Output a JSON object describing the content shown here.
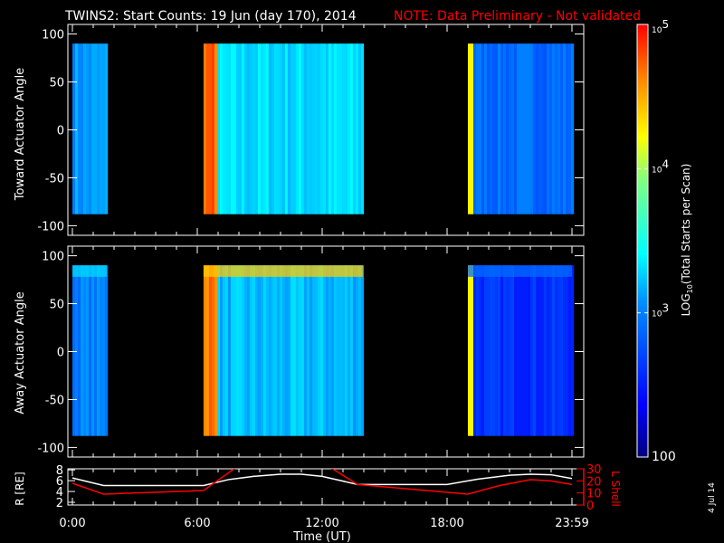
{
  "title": "TWINS2: Start Counts: 19 Jun (day 170), 2014",
  "note": "NOTE: Data Preliminary - Not validated",
  "date_stamp": "4 Jul 14",
  "colors": {
    "background": "#000000",
    "axes": "#ffffff",
    "note": "#ff0000",
    "r_line": "#ffffff",
    "lshell_line": "#ff0000"
  },
  "chart_data": [
    {
      "type": "heatmap",
      "name": "toward",
      "ylabel": "Toward Actuator Angle",
      "ylim": [
        -110,
        110
      ],
      "yticks": [
        "100",
        "50",
        "0",
        "-50",
        "-100"
      ],
      "ytick_values": [
        100,
        50,
        0,
        -50,
        -100
      ],
      "data_angle_range": [
        -88,
        90
      ],
      "data_segments_hours": [
        [
          0,
          1.65
        ],
        [
          6.3,
          13.95
        ],
        [
          19.0,
          24.0
        ]
      ],
      "segment_levels_log10": [
        3.1,
        3.3,
        2.9
      ]
    },
    {
      "type": "heatmap",
      "name": "away",
      "ylabel": "Away Actuator Angle",
      "ylim": [
        -110,
        110
      ],
      "yticks": [
        "100",
        "50",
        "0",
        "-50",
        "-100"
      ],
      "ytick_values": [
        100,
        50,
        0,
        -50,
        -100
      ],
      "data_angle_range": [
        -88,
        90
      ],
      "data_segments_hours": [
        [
          0,
          1.65
        ],
        [
          6.3,
          13.95
        ],
        [
          19.0,
          24.0
        ]
      ],
      "segment_levels_log10": [
        3.0,
        3.2,
        2.6
      ]
    },
    {
      "type": "line",
      "name": "orbit",
      "ylabel": "R [RE]",
      "y2label": "L Shell",
      "ylim": [
        1.5,
        8.2
      ],
      "y2lim": [
        0,
        30
      ],
      "yticks": [
        "8",
        "6",
        "4",
        "2"
      ],
      "ytick_values": [
        8,
        6,
        4,
        2
      ],
      "y2ticks": [
        "30",
        "20",
        "10",
        "0"
      ],
      "y2tick_values": [
        30,
        20,
        10,
        0
      ],
      "xlabel": "Time (UT)",
      "xticks": [
        "0:00",
        "6:00",
        "12:00",
        "18:00",
        "23:59"
      ],
      "xtick_values": [
        0,
        6,
        12,
        18,
        24
      ],
      "series": [
        {
          "name": "R",
          "x": [
            0,
            1.5,
            6.3,
            7.5,
            8.7,
            10,
            11,
            12,
            13.7,
            18,
            19.5,
            21,
            22,
            23,
            24
          ],
          "y": [
            6.5,
            5.1,
            5.1,
            6.2,
            6.8,
            7.2,
            7.2,
            6.8,
            5.3,
            5.3,
            6.3,
            7.0,
            7.2,
            7.1,
            6.4
          ]
        },
        {
          "name": "L Shell",
          "x": [
            0,
            1.5,
            6.3,
            7.85,
            12.4,
            13.7,
            19,
            20.5,
            22,
            23,
            24
          ],
          "y": [
            18,
            9,
            12,
            31,
            31,
            17,
            9,
            16,
            21,
            20,
            17
          ]
        }
      ]
    }
  ],
  "colorbar": {
    "label": "LOG10(Total Starts per Scan)",
    "label_main": "LOG",
    "label_sub": "10",
    "label_rest": "(Total Starts per Scan)",
    "ticks": [
      {
        "base": "10",
        "exp": "5",
        "value": 5
      },
      {
        "base": "10",
        "exp": "4",
        "value": 4
      },
      {
        "base": "10",
        "exp": "3",
        "value": 3
      }
    ],
    "min_label": "100",
    "range_log10": [
      2,
      5
    ]
  }
}
